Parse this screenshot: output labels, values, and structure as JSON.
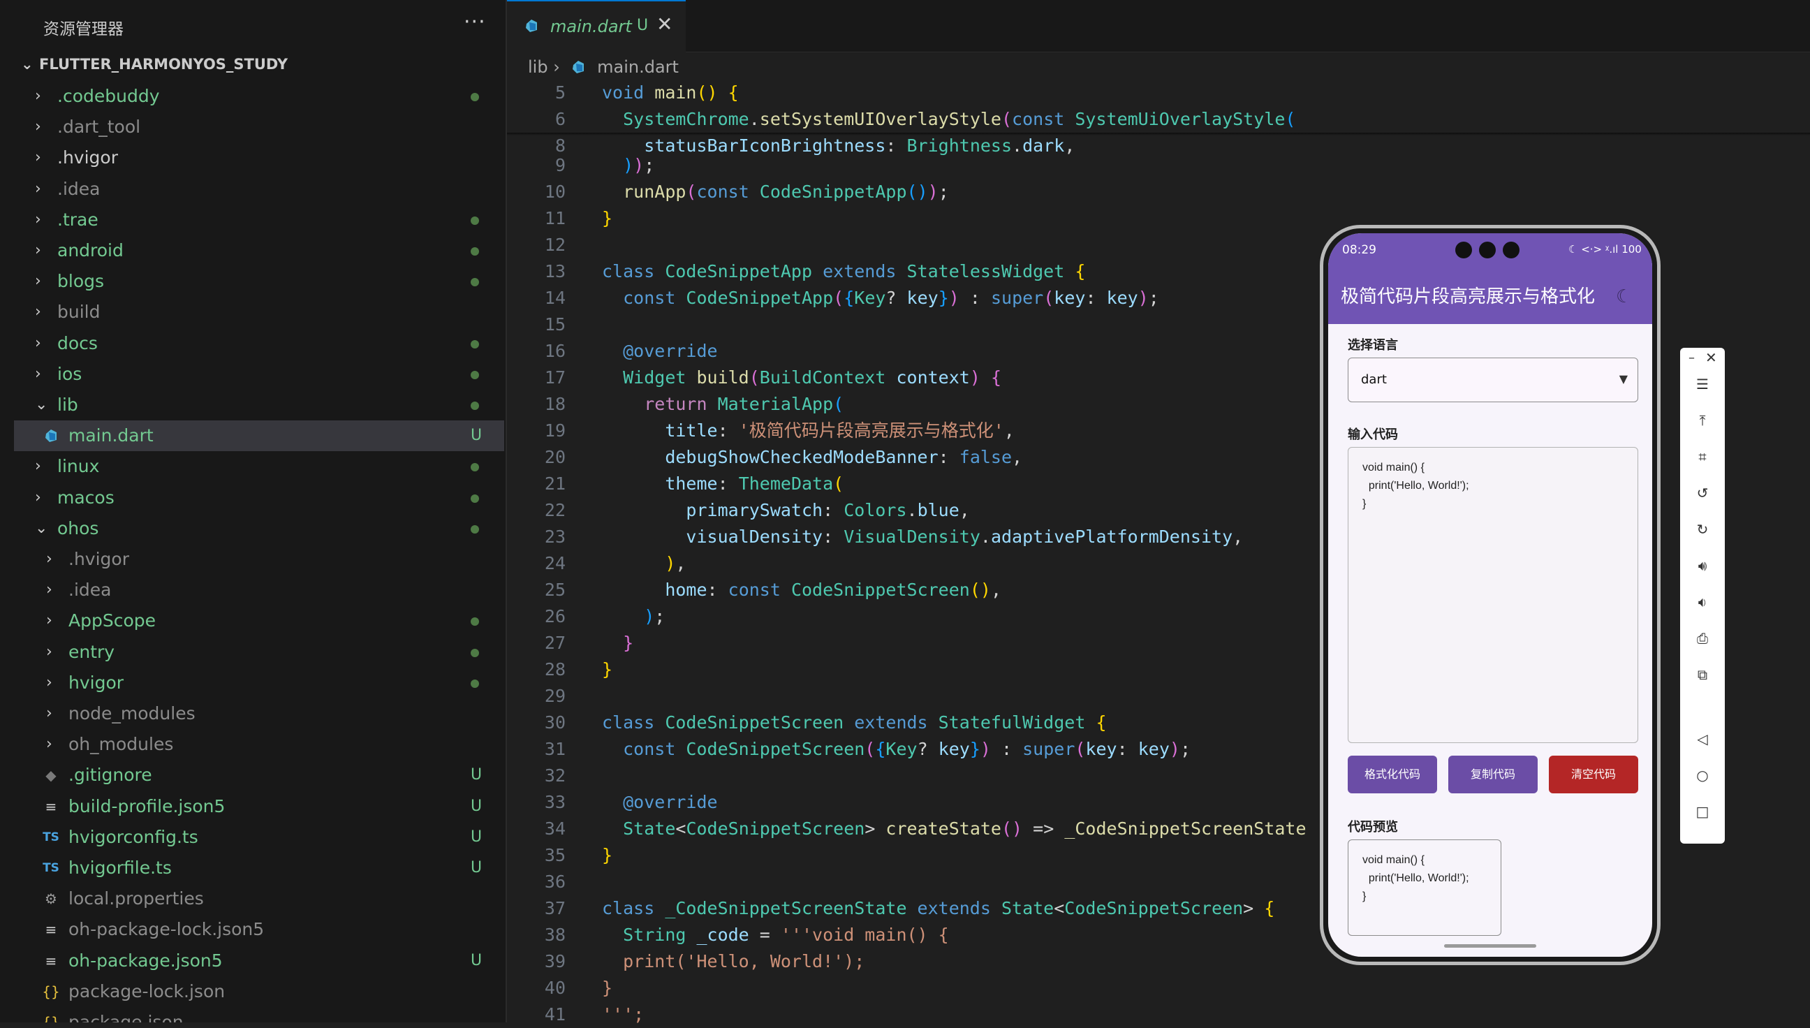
{
  "explorer": {
    "title": "资源管理器",
    "more_icon": "···",
    "project": "FLUTTER_HARMONYOS_STUDY",
    "items": [
      {
        "label": ".codebuddy",
        "color": "green",
        "status": "dot",
        "type": "folder",
        "depth": 0,
        "open": false
      },
      {
        "label": ".dart_tool",
        "color": "grey",
        "status": "",
        "type": "folder",
        "depth": 0,
        "open": false
      },
      {
        "label": ".hvigor",
        "color": "white",
        "status": "",
        "type": "folder",
        "depth": 0,
        "open": false
      },
      {
        "label": ".idea",
        "color": "grey",
        "status": "",
        "type": "folder",
        "depth": 0,
        "open": false
      },
      {
        "label": ".trae",
        "color": "green",
        "status": "dot",
        "type": "folder",
        "depth": 0,
        "open": false
      },
      {
        "label": "android",
        "color": "green",
        "status": "dot",
        "type": "folder",
        "depth": 0,
        "open": false
      },
      {
        "label": "blogs",
        "color": "green",
        "status": "dot",
        "type": "folder",
        "depth": 0,
        "open": false
      },
      {
        "label": "build",
        "color": "grey",
        "status": "",
        "type": "folder",
        "depth": 0,
        "open": false
      },
      {
        "label": "docs",
        "color": "green",
        "status": "dot",
        "type": "folder",
        "depth": 0,
        "open": false
      },
      {
        "label": "ios",
        "color": "green",
        "status": "dot",
        "type": "folder",
        "depth": 0,
        "open": false
      },
      {
        "label": "lib",
        "color": "green",
        "status": "dot",
        "type": "folder",
        "depth": 0,
        "open": true
      },
      {
        "label": "main.dart",
        "color": "green",
        "status": "U",
        "type": "dart",
        "depth": 1,
        "selected": true
      },
      {
        "label": "linux",
        "color": "green",
        "status": "dot",
        "type": "folder",
        "depth": 0,
        "open": false
      },
      {
        "label": "macos",
        "color": "green",
        "status": "dot",
        "type": "folder",
        "depth": 0,
        "open": false
      },
      {
        "label": "ohos",
        "color": "green",
        "status": "dot",
        "type": "folder",
        "depth": 0,
        "open": true
      },
      {
        "label": ".hvigor",
        "color": "grey",
        "status": "",
        "type": "folder",
        "depth": 1,
        "open": false
      },
      {
        "label": ".idea",
        "color": "grey",
        "status": "",
        "type": "folder",
        "depth": 1,
        "open": false
      },
      {
        "label": "AppScope",
        "color": "green",
        "status": "dot",
        "type": "folder",
        "depth": 1,
        "open": false
      },
      {
        "label": "entry",
        "color": "green",
        "status": "dot",
        "type": "folder",
        "depth": 1,
        "open": false
      },
      {
        "label": "hvigor",
        "color": "green",
        "status": "dot",
        "type": "folder",
        "depth": 1,
        "open": false
      },
      {
        "label": "node_modules",
        "color": "grey",
        "status": "",
        "type": "folder",
        "depth": 1,
        "open": false
      },
      {
        "label": "oh_modules",
        "color": "grey",
        "status": "",
        "type": "folder",
        "depth": 1,
        "open": false
      },
      {
        "label": ".gitignore",
        "color": "green",
        "status": "U",
        "type": "git",
        "depth": 1
      },
      {
        "label": "build-profile.json5",
        "color": "green",
        "status": "U",
        "type": "lines",
        "depth": 1
      },
      {
        "label": "hvigorconfig.ts",
        "color": "green",
        "status": "U",
        "type": "ts",
        "depth": 1
      },
      {
        "label": "hvigorfile.ts",
        "color": "green",
        "status": "U",
        "type": "ts",
        "depth": 1
      },
      {
        "label": "local.properties",
        "color": "grey",
        "status": "",
        "type": "gear",
        "depth": 1
      },
      {
        "label": "oh-package-lock.json5",
        "color": "grey",
        "status": "",
        "type": "lines",
        "depth": 1
      },
      {
        "label": "oh-package.json5",
        "color": "green",
        "status": "U",
        "type": "lines",
        "depth": 1
      },
      {
        "label": "package-lock.json",
        "color": "grey",
        "status": "",
        "type": "json",
        "depth": 1
      },
      {
        "label": "package.json",
        "color": "grey",
        "status": "",
        "type": "json",
        "depth": 1
      }
    ]
  },
  "tab": {
    "name": "main.dart",
    "status": "U",
    "close": "✕"
  },
  "breadcrumb": {
    "folder": "lib",
    "sep": "›",
    "file": "main.dart"
  },
  "code_lines": [
    {
      "n": "5",
      "t": [
        [
          "kw",
          "void "
        ],
        [
          "fn",
          "main"
        ],
        [
          "br1",
          "() "
        ],
        [
          "br1",
          "{"
        ]
      ]
    },
    {
      "n": "6",
      "t": [
        [
          "",
          "  "
        ],
        [
          "ty",
          "SystemChrome"
        ],
        [
          "punct",
          "."
        ],
        [
          "fn",
          "setSystemUIOverlayStyle"
        ],
        [
          "br2",
          "("
        ],
        [
          "kw",
          "const "
        ],
        [
          "ty",
          "SystemUiOverlayStyle"
        ],
        [
          "br3",
          "("
        ]
      ]
    },
    {
      "n": "8",
      "t": [
        [
          "",
          "    "
        ],
        [
          "prop",
          "statusBarIconBrightness"
        ],
        [
          "punct",
          ": "
        ],
        [
          "ty",
          "Brightness"
        ],
        [
          "punct",
          "."
        ],
        [
          "prop",
          "dark"
        ],
        [
          "punct",
          ","
        ]
      ]
    },
    {
      "n": "9",
      "t": [
        [
          "",
          "  "
        ],
        [
          "br3",
          ")"
        ],
        [
          "br2",
          ")"
        ],
        [
          "punct",
          ";"
        ]
      ]
    },
    {
      "n": "10",
      "t": [
        [
          "",
          "  "
        ],
        [
          "fn",
          "runApp"
        ],
        [
          "br2",
          "("
        ],
        [
          "kw",
          "const "
        ],
        [
          "ty",
          "CodeSnippetApp"
        ],
        [
          "br3",
          "()"
        ],
        [
          "br2",
          ")"
        ],
        [
          "punct",
          ";"
        ]
      ]
    },
    {
      "n": "11",
      "t": [
        [
          "br1",
          "}"
        ]
      ]
    },
    {
      "n": "12",
      "t": []
    },
    {
      "n": "13",
      "t": [
        [
          "kw",
          "class "
        ],
        [
          "ty",
          "CodeSnippetApp "
        ],
        [
          "kw",
          "extends "
        ],
        [
          "ty",
          "StatelessWidget "
        ],
        [
          "br1",
          "{"
        ]
      ]
    },
    {
      "n": "14",
      "t": [
        [
          "",
          "  "
        ],
        [
          "kw",
          "const "
        ],
        [
          "ty",
          "CodeSnippetApp"
        ],
        [
          "br2",
          "("
        ],
        [
          "br3",
          "{"
        ],
        [
          "ty",
          "Key"
        ],
        [
          "punct",
          "? "
        ],
        [
          "prop",
          "key"
        ],
        [
          "br3",
          "}"
        ],
        [
          "br2",
          ")"
        ],
        [
          "punct",
          " : "
        ],
        [
          "kw",
          "super"
        ],
        [
          "br2",
          "("
        ],
        [
          "prop",
          "key"
        ],
        [
          "punct",
          ": "
        ],
        [
          "prop",
          "key"
        ],
        [
          "br2",
          ")"
        ],
        [
          "punct",
          ";"
        ]
      ]
    },
    {
      "n": "15",
      "t": []
    },
    {
      "n": "16",
      "t": [
        [
          "",
          "  "
        ],
        [
          "kw",
          "@override"
        ]
      ]
    },
    {
      "n": "17",
      "t": [
        [
          "",
          "  "
        ],
        [
          "ty",
          "Widget "
        ],
        [
          "fn",
          "build"
        ],
        [
          "br2",
          "("
        ],
        [
          "ty",
          "BuildContext "
        ],
        [
          "prop",
          "context"
        ],
        [
          "br2",
          ") "
        ],
        [
          "br2",
          "{"
        ]
      ]
    },
    {
      "n": "18",
      "t": [
        [
          "",
          "    "
        ],
        [
          "ctl",
          "return "
        ],
        [
          "ty",
          "MaterialApp"
        ],
        [
          "br3",
          "("
        ]
      ]
    },
    {
      "n": "19",
      "t": [
        [
          "",
          "      "
        ],
        [
          "prop",
          "title"
        ],
        [
          "punct",
          ": "
        ],
        [
          "str",
          "'极简代码片段高亮展示与格式化'"
        ],
        [
          "punct",
          ","
        ]
      ]
    },
    {
      "n": "20",
      "t": [
        [
          "",
          "      "
        ],
        [
          "prop",
          "debugShowCheckedModeBanner"
        ],
        [
          "punct",
          ": "
        ],
        [
          "kw",
          "false"
        ],
        [
          "punct",
          ","
        ]
      ]
    },
    {
      "n": "21",
      "t": [
        [
          "",
          "      "
        ],
        [
          "prop",
          "theme"
        ],
        [
          "punct",
          ": "
        ],
        [
          "ty",
          "ThemeData"
        ],
        [
          "br1",
          "("
        ]
      ]
    },
    {
      "n": "22",
      "t": [
        [
          "",
          "        "
        ],
        [
          "prop",
          "primarySwatch"
        ],
        [
          "punct",
          ": "
        ],
        [
          "ty",
          "Colors"
        ],
        [
          "punct",
          "."
        ],
        [
          "prop",
          "blue"
        ],
        [
          "punct",
          ","
        ]
      ]
    },
    {
      "n": "23",
      "t": [
        [
          "",
          "        "
        ],
        [
          "prop",
          "visualDensity"
        ],
        [
          "punct",
          ": "
        ],
        [
          "ty",
          "VisualDensity"
        ],
        [
          "punct",
          "."
        ],
        [
          "prop",
          "adaptivePlatformDensity"
        ],
        [
          "punct",
          ","
        ]
      ]
    },
    {
      "n": "24",
      "t": [
        [
          "",
          "      "
        ],
        [
          "br1",
          ")"
        ],
        [
          "punct",
          ","
        ]
      ]
    },
    {
      "n": "25",
      "t": [
        [
          "",
          "      "
        ],
        [
          "prop",
          "home"
        ],
        [
          "punct",
          ": "
        ],
        [
          "kw",
          "const "
        ],
        [
          "ty",
          "CodeSnippetScreen"
        ],
        [
          "br1",
          "()"
        ],
        [
          "punct",
          ","
        ]
      ]
    },
    {
      "n": "26",
      "t": [
        [
          "",
          "    "
        ],
        [
          "br3",
          ")"
        ],
        [
          "punct",
          ";"
        ]
      ]
    },
    {
      "n": "27",
      "t": [
        [
          "",
          "  "
        ],
        [
          "br2",
          "}"
        ]
      ]
    },
    {
      "n": "28",
      "t": [
        [
          "br1",
          "}"
        ]
      ]
    },
    {
      "n": "29",
      "t": []
    },
    {
      "n": "30",
      "t": [
        [
          "kw",
          "class "
        ],
        [
          "ty",
          "CodeSnippetScreen "
        ],
        [
          "kw",
          "extends "
        ],
        [
          "ty",
          "StatefulWidget "
        ],
        [
          "br1",
          "{"
        ]
      ]
    },
    {
      "n": "31",
      "t": [
        [
          "",
          "  "
        ],
        [
          "kw",
          "const "
        ],
        [
          "ty",
          "CodeSnippetScreen"
        ],
        [
          "br2",
          "("
        ],
        [
          "br3",
          "{"
        ],
        [
          "ty",
          "Key"
        ],
        [
          "punct",
          "? "
        ],
        [
          "prop",
          "key"
        ],
        [
          "br3",
          "}"
        ],
        [
          "br2",
          ")"
        ],
        [
          "punct",
          " : "
        ],
        [
          "kw",
          "super"
        ],
        [
          "br2",
          "("
        ],
        [
          "prop",
          "key"
        ],
        [
          "punct",
          ": "
        ],
        [
          "prop",
          "key"
        ],
        [
          "br2",
          ")"
        ],
        [
          "punct",
          ";"
        ]
      ]
    },
    {
      "n": "32",
      "t": []
    },
    {
      "n": "33",
      "t": [
        [
          "",
          "  "
        ],
        [
          "kw",
          "@override"
        ]
      ]
    },
    {
      "n": "34",
      "t": [
        [
          "",
          "  "
        ],
        [
          "ty",
          "State"
        ],
        [
          "punct",
          "<"
        ],
        [
          "ty",
          "CodeSnippetScreen"
        ],
        [
          "punct",
          "> "
        ],
        [
          "fn",
          "createState"
        ],
        [
          "br2",
          "()"
        ],
        [
          "punct",
          " => "
        ],
        [
          "fn",
          "_CodeSnippetScreenState"
        ]
      ]
    },
    {
      "n": "35",
      "t": [
        [
          "br1",
          "}"
        ]
      ]
    },
    {
      "n": "36",
      "t": []
    },
    {
      "n": "37",
      "t": [
        [
          "kw",
          "class "
        ],
        [
          "ty",
          "_CodeSnippetScreenState "
        ],
        [
          "kw",
          "extends "
        ],
        [
          "ty",
          "State"
        ],
        [
          "punct",
          "<"
        ],
        [
          "ty",
          "CodeSnippetScreen"
        ],
        [
          "punct",
          "> "
        ],
        [
          "br1",
          "{"
        ]
      ]
    },
    {
      "n": "38",
      "t": [
        [
          "",
          "  "
        ],
        [
          "ty",
          "String "
        ],
        [
          "prop",
          "_code"
        ],
        [
          "punct",
          " = "
        ],
        [
          "str",
          "'''void main() {"
        ]
      ]
    },
    {
      "n": "39",
      "t": [
        [
          "",
          "  "
        ],
        [
          "str",
          "print('Hello, World!');"
        ]
      ]
    },
    {
      "n": "40",
      "t": [
        [
          "str",
          "}"
        ]
      ]
    },
    {
      "n": "41",
      "t": [
        [
          "str",
          "''';"
        ]
      ]
    }
  ],
  "phone": {
    "time": "08:29",
    "status_icons": "☾ <·> ᵡ.ıl 100",
    "app_title": "极简代码片段高亮展示与格式化",
    "theme_icon": "☾",
    "language_label": "选择语言",
    "language_value": "dart",
    "input_label": "输入代码",
    "input_code": "void main() {\n  print('Hello, World!');\n}",
    "buttons": {
      "format": "格式化代码",
      "copy": "复制代码",
      "clear": "清空代码"
    },
    "preview_label": "代码预览",
    "preview_code": "void main() {\n  print('Hello, World!');\n}"
  },
  "emulator_toolbar": {
    "minimize": "–",
    "close": "✕",
    "tools": [
      "menu-icon",
      "pin-top-icon",
      "crop-icon",
      "rotate-left-icon",
      "rotate-right-icon",
      "volume-up-icon",
      "volume-down-icon",
      "screenshot-icon",
      "multi-device-icon",
      "back-icon",
      "home-icon",
      "recent-apps-icon"
    ]
  },
  "colors": {
    "accent": "#0078d4",
    "git_untracked": "#73c991",
    "app_primary": "#7054b4",
    "danger": "#b42626"
  }
}
